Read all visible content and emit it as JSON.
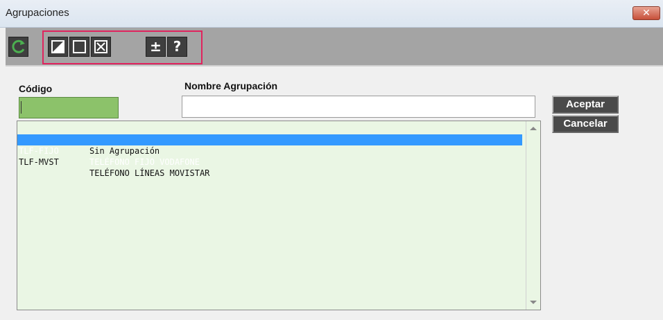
{
  "window": {
    "title": "Agrupaciones",
    "close_glyph": "✕"
  },
  "toolbar": {
    "buttons": [
      {
        "icon": "refresh-icon"
      },
      {
        "icon": "half-square-icon"
      },
      {
        "icon": "empty-square-icon"
      },
      {
        "icon": "x-square-icon"
      },
      {
        "icon": "plus-minus-icon",
        "glyph": "±"
      },
      {
        "icon": "help-icon",
        "glyph": "?"
      }
    ],
    "highlight_color": "#e0245e"
  },
  "form": {
    "code_label": "Código",
    "code_value": "",
    "name_label": "Nombre Agrupación",
    "name_value": ""
  },
  "list": {
    "rows": [
      {
        "code": "",
        "name": "Sin Agrupación",
        "selected": false
      },
      {
        "code": "TLF-FIJO",
        "name": "TELÉFONO FIJO VODAFONE",
        "selected": true
      },
      {
        "code": "TLF-MVST",
        "name": "TELÉFONO LÍNEAS MOVISTAR",
        "selected": false
      }
    ]
  },
  "actions": {
    "accept_label": "Aceptar",
    "cancel_label": "Cancelar"
  },
  "colors": {
    "selection": "#3399ff",
    "list_bg": "#eaf6e4",
    "code_input_bg": "#8cc26a",
    "toolbar_bg": "#a4a4a4"
  }
}
